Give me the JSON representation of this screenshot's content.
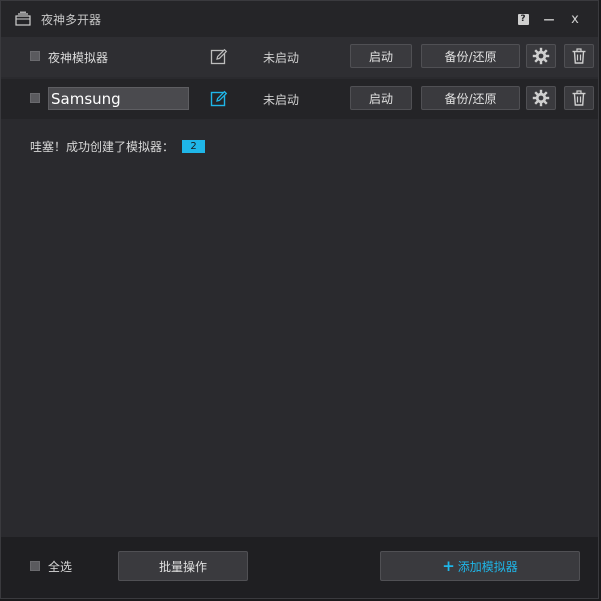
{
  "window": {
    "title": "夜神多开器"
  },
  "title_controls": {
    "help": "?",
    "minimize": "—",
    "close": "x"
  },
  "emulators": [
    {
      "name": "夜神模拟器",
      "editing": false,
      "status": "未启动",
      "start_label": "启动",
      "backup_label": "备份/还原"
    },
    {
      "name": "Samsung",
      "editing": true,
      "status": "未启动",
      "start_label": "启动",
      "backup_label": "备份/还原"
    }
  ],
  "notice": {
    "text": "哇塞！成功创建了模拟器：",
    "count": "2"
  },
  "footer": {
    "select_all": "全选",
    "batch_label": "批量操作",
    "add_plus": "+",
    "add_label": "添加模拟器"
  },
  "colors": {
    "accent": "#1fb6e8",
    "background": "#2a2a2e",
    "titlebar": "#252528",
    "footer": "#1f1f22"
  },
  "icons": {
    "app": "window-icon",
    "edit": "edit-icon",
    "settings": "gear-icon",
    "delete": "trash-icon"
  }
}
